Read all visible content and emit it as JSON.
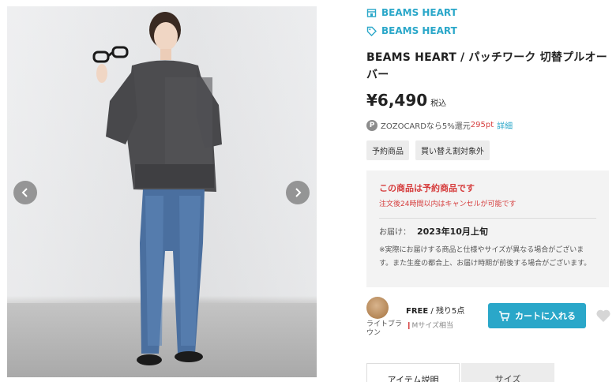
{
  "gallery": {
    "prev_icon": "chevron-left-icon",
    "next_icon": "chevron-right-icon"
  },
  "brand": {
    "shop_label": "BEAMS HEART",
    "brand_label": "BEAMS HEART",
    "shop_icon": "store-icon",
    "brand_icon": "tag-icon",
    "color": "#2aa7c9"
  },
  "product": {
    "title": "BEAMS HEART / パッチワーク 切替プルオーバー",
    "price": "¥6,490",
    "tax_label": "税込"
  },
  "points": {
    "icon_letter": "P",
    "prefix": "ZOZOCARDなら",
    "rate": "5%還元",
    "points_value": "295pt",
    "detail_link": "詳細"
  },
  "tags": [
    "予約商品",
    "買い替え割対象外"
  ],
  "notice": {
    "title": "この商品は予約商品です",
    "subtitle": "注文後24時間以内はキャンセルが可能です",
    "delivery_label": "お届け：",
    "delivery_value": "2023年10月上旬",
    "note": "※実際にお届けする商品と仕様やサイズが異なる場合がございます。また生産の都合上、お届け時期が前後する場合がございます。"
  },
  "sku": {
    "color_name": "ライトブラウン",
    "size_label": "FREE",
    "stock_label": "残り5点",
    "fit_label": "Mサイズ相当",
    "cart_label": "カートに入れる",
    "cart_icon": "cart-icon",
    "favorite_icon": "heart-icon"
  },
  "tabs": [
    "アイテム説明",
    "サイズ"
  ],
  "colors": {
    "accent": "#2aa7c9",
    "alert": "#d63e3e"
  }
}
